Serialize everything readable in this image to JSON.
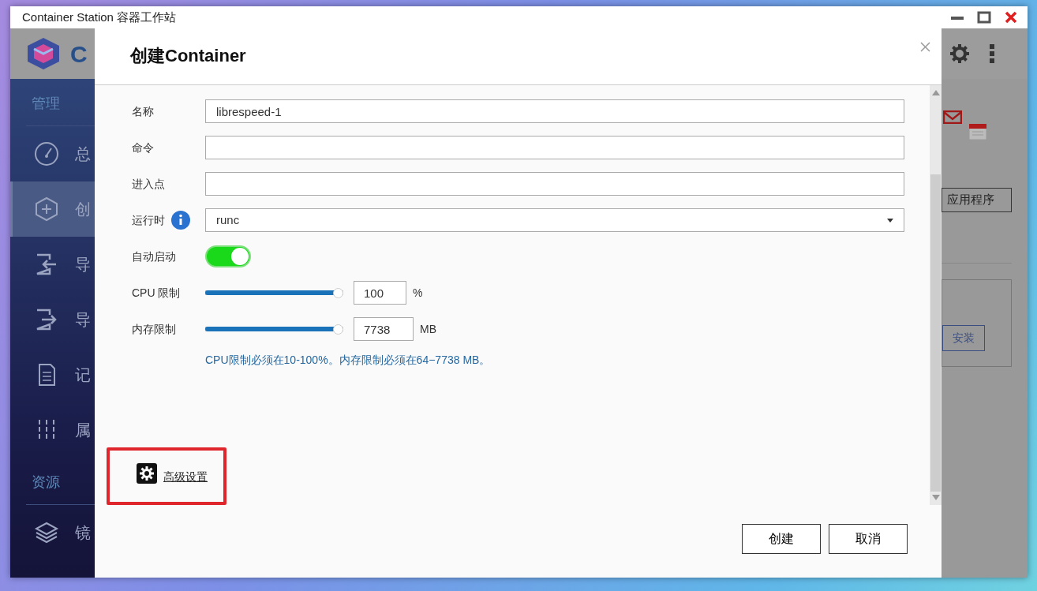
{
  "window": {
    "title": "Container Station 容器工作站"
  },
  "app": {
    "logo_text": "C",
    "sidebar": [
      {
        "heading": "管理",
        "items": [
          {
            "label": "总",
            "selected": false
          },
          {
            "label": "创",
            "selected": true
          },
          {
            "label": "导",
            "selected": false
          },
          {
            "label": "导",
            "selected": false
          },
          {
            "label": "记",
            "selected": false
          },
          {
            "label": "属",
            "selected": false
          }
        ]
      },
      {
        "heading": "资源",
        "items": [
          {
            "label": "镜",
            "selected": false
          }
        ]
      }
    ],
    "background_buttons": [
      "应用程序",
      "安装"
    ]
  },
  "dialog": {
    "title": "创建Container",
    "fields": [
      {
        "kind": "text",
        "label": "名称",
        "value": "librespeed-1"
      },
      {
        "kind": "text",
        "label": "命令"
      },
      {
        "kind": "text",
        "label": "进入点"
      },
      {
        "kind": "select",
        "label": "运行时",
        "info": true,
        "value": "runc"
      },
      {
        "kind": "toggle",
        "label": "自动启动",
        "on": true
      },
      {
        "kind": "slider",
        "label": "CPU 限制",
        "level": 1,
        "value": "100",
        "unit": "%"
      },
      {
        "kind": "slider",
        "label": "内存限制",
        "level": 1,
        "value": "7738",
        "unit": "MB"
      }
    ],
    "hint": "CPU限制必须在10-100%。内存限制必须在64−7738 MB。",
    "advanced_link": "高级设置",
    "buttons": [
      "创建",
      "取消"
    ]
  }
}
